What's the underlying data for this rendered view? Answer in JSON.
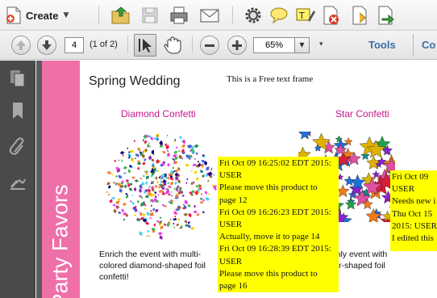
{
  "toolbar": {
    "create_label": "Create",
    "icons": [
      "open-folder-icon",
      "save-icon",
      "print-icon",
      "email-icon",
      "gear-icon",
      "comment-bubble-icon",
      "highlight-text-icon",
      "stamp-icon",
      "attach-file-icon",
      "export-icon"
    ]
  },
  "navbar": {
    "page_number": "4",
    "page_count": "(1 of 2)",
    "zoom": "65%",
    "tools_label": "Tools",
    "comment_label": "Co"
  },
  "page": {
    "band_text": "Party Favors",
    "title": "Spring Wedding",
    "free_text": "This is a Free text frame",
    "product1": {
      "heading": "Diamond Confetti",
      "description": "Enrich the event with multi-colored diamond-shaped foil confetti!"
    },
    "product2": {
      "heading": "Star Confetti",
      "desc_line1": "heavenly event with",
      "desc_line2": "red star-shaped foil"
    },
    "note1": [
      "Fri Oct 09 16:25:02 EDT 2015:",
      "USER",
      "Please move this product to",
      "page 12",
      "Fri Oct 09 16:26:23 EDT 2015:",
      "USER",
      "Actually, move it to page 14",
      "Fri Oct 09 16:28:39 EDT 2015:",
      "USER",
      "Please move this product to",
      "page 16"
    ],
    "note2": [
      "Fri Oct 09",
      "USER",
      "Needs new i",
      "Thu Oct 15",
      "2015: USER",
      "I edited this"
    ]
  },
  "colors": {
    "band": "#ef6fa8",
    "heading": "#c2188a",
    "note": "#ffff00",
    "link": "#3a6ea5"
  }
}
